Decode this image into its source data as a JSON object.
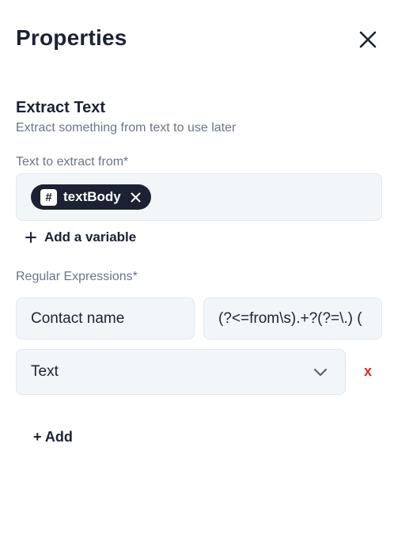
{
  "header": {
    "title": "Properties",
    "close_icon": "close-icon"
  },
  "section": {
    "title": "Extract Text",
    "subtitle": "Extract something from text to use later"
  },
  "text_source": {
    "label": "Text to extract from*",
    "variable_chip": {
      "icon": "hash-icon",
      "label": "textBody"
    },
    "add_variable_label": "Add a variable"
  },
  "regex": {
    "label": "Regular Expressions*",
    "rows": [
      {
        "name_value": "Contact name",
        "pattern_value": "(?<=from\\s).+?(?=\\.) (",
        "type_value": "Text",
        "remove_label": "x"
      }
    ],
    "add_label": "+ Add"
  },
  "colors": {
    "chip_bg": "#1c2233",
    "field_bg": "#f3f6f8",
    "remove": "#e0262b",
    "muted_text": "#6b7488"
  }
}
